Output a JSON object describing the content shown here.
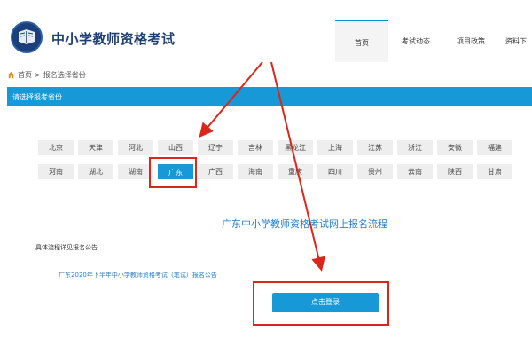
{
  "header": {
    "site_title": "中小学教师资格考试",
    "nav": [
      {
        "label": "首页",
        "active": true
      },
      {
        "label": "考试动态",
        "active": false
      },
      {
        "label": "项目政策",
        "active": false
      },
      {
        "label": "资料下",
        "active": false
      }
    ]
  },
  "breadcrumb": {
    "home": "首页",
    "separator": ">",
    "current": "报名选择省份"
  },
  "section_bar": {
    "label": "请选择报考省份"
  },
  "provinces": {
    "row1": [
      "北京",
      "天津",
      "河北",
      "山西",
      "辽宁",
      "吉林",
      "黑龙江",
      "上海",
      "江苏",
      "浙江",
      "安徽",
      "福建"
    ],
    "row2": [
      "河南",
      "湖北",
      "湖南",
      "广东",
      "广西",
      "海南",
      "重庆",
      "四川",
      "贵州",
      "云南",
      "陕西",
      "甘肃"
    ],
    "selected": "广东"
  },
  "content": {
    "flow_title": "广东中小学教师资格考试网上报名流程",
    "detail_label": "具体流程详见报名公告",
    "notice_link": "广东2020年下半年中小学教师资格考试（笔试）报名公告",
    "login_button": "点击登录"
  },
  "colors": {
    "accent": "#1799d8",
    "title": "#1e3f75",
    "annotation": "#d9271c"
  }
}
